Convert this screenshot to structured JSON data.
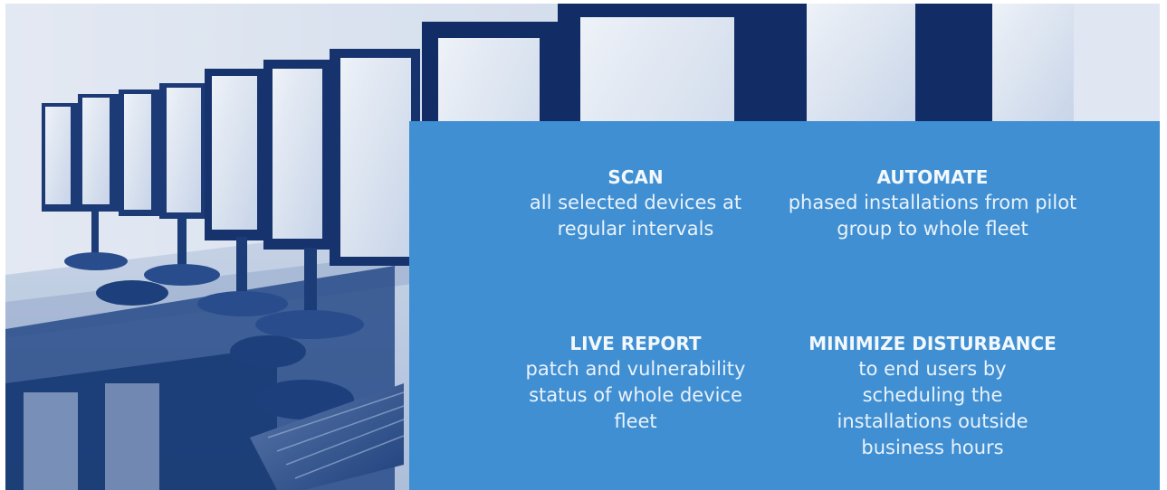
{
  "background_image": {
    "description_icon": "computer-lab-photo",
    "tint": "#1f3f7a"
  },
  "panel": {
    "color": "#3f8fd2",
    "features": [
      {
        "title": "SCAN",
        "description": "all selected devices at regular intervals"
      },
      {
        "title": "AUTOMATE",
        "description": "phased installations from pilot group to whole fleet"
      },
      {
        "title": "LIVE REPORT",
        "description": "patch and vulnerability status of whole device fleet"
      },
      {
        "title": "MINIMIZE DISTURBANCE",
        "description": "to end users by scheduling the installations outside business hours"
      }
    ]
  }
}
